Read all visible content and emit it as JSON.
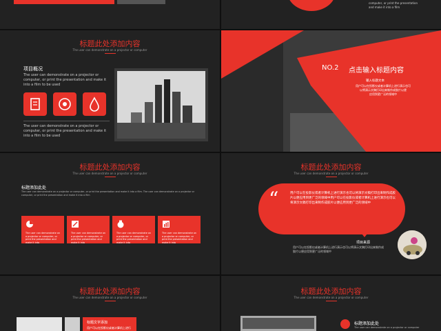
{
  "colors": {
    "accent": "#e8332a",
    "bg": "#222222",
    "frame": "#0f0f0f"
  },
  "slides": {
    "s1": {
      "text_lines": [
        "computer, or print the presentation",
        "and make it into a film"
      ]
    },
    "s3": {
      "title": "标题此处添加内容",
      "subtitle": "The user can demonstrate on a projector or computer",
      "heading": "项目概况",
      "body1": "The user can demonstrate on a projector or computer, or print the presentation and make it into a film to be used",
      "body2": "The user can demonstrate on a projector or computer, or print the presentation and make it into a film to be used",
      "icons": [
        "document-icon",
        "target-icon",
        "drop-icon"
      ]
    },
    "s4": {
      "number": "NO.2",
      "title": "点击输入标题内容",
      "sub_heading": "输入标题文本",
      "lines": [
        "用户可以在投影仪或者计算机上进行演示也可",
        "以将演示文稿打印出来制作成胶片以便",
        "应用到更广泛的领域中"
      ]
    },
    "s5": {
      "title": "标题此处添加内容",
      "subtitle": "The user can demonstrate on a projector or computer",
      "heading": "标题添加此处",
      "body": "The user can demonstrate on a projector or computer, or print the presentation and make it into a film. The user can demonstrate on a projector or computer, or print the presentation and make it into a film",
      "cards": [
        {
          "icon": "pie-chart-icon",
          "text": "The user can demonstrate on a projector or computer, or print the presentation and make it into"
        },
        {
          "icon": "edit-icon",
          "text": "The user can demonstrate on a projector or computer, or print the presentation and make it into"
        },
        {
          "icon": "money-bag-icon",
          "text": "The user can demonstrate on a projector or computer, or print the presentation and make it into"
        },
        {
          "icon": "chart-icon",
          "text": "The user can demonstrate on a projector or computer, or print the presentation and make it into"
        }
      ]
    },
    "s6": {
      "title": "标题此处添加内容",
      "subtitle": "The user can demonstrate on a projector or computer",
      "quote": "用户可以在投影仪或者计算机上进行演示也可以将演示文稿打印出来制作成胶片以便应用到更广泛的领域中用户可以在投影仪或者计算机上进行演示也可以将演示文稿打印出来制作成胶片以便应用到更广泛的领域中",
      "source_label": "项目来源",
      "source_text": "用户可以在投影仪或者计算机上进行演示也可以将演示文稿打印出来制作成胶片以便应用到更广泛的领域中"
    },
    "s7": {
      "title": "标题此处添加内容",
      "subtitle": "The user can demonstrate on a projector or computer",
      "label": "标题文字添加",
      "label_text": "用户可以在投影仪或者计算机上进行"
    },
    "s8": {
      "title": "标题此处添加内容",
      "subtitle": "The user can demonstrate on a projector or computer",
      "heading": "标题添加此处",
      "body": "The user can demonstrate on a projector or computer"
    }
  }
}
